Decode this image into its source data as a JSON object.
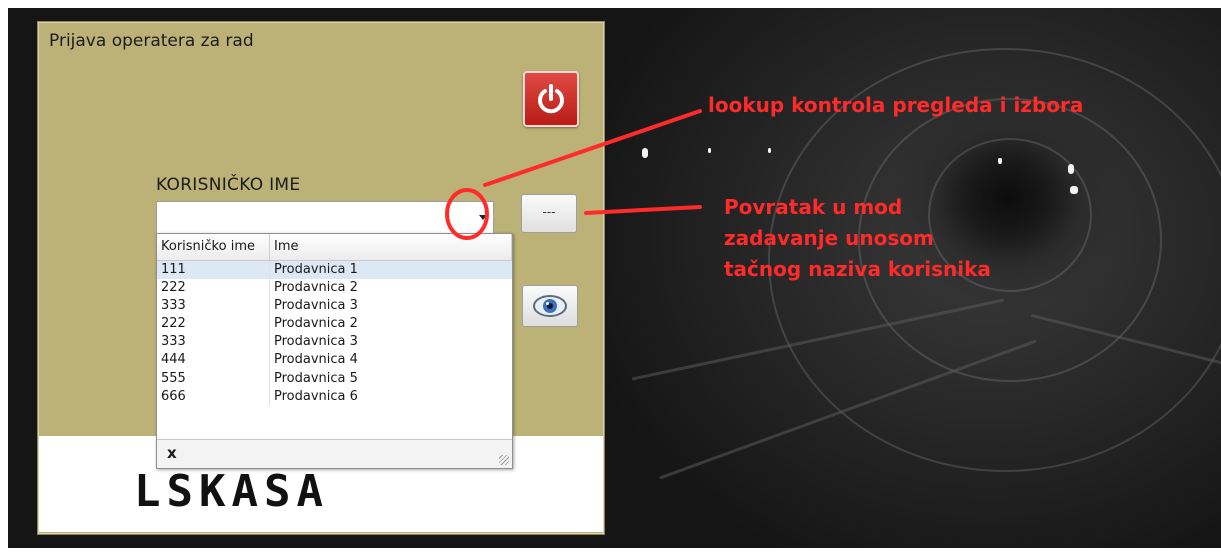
{
  "window": {
    "title": "Prijava operatera za rad"
  },
  "login": {
    "field_label": "KORISNIČKO IME",
    "username_value": "",
    "dots_button_label": "---"
  },
  "lookup": {
    "columns": [
      "Korisničko ime",
      "Ime"
    ],
    "rows": [
      {
        "code": "111",
        "name": "Prodavnica 1"
      },
      {
        "code": "222",
        "name": "Prodavnica 2"
      },
      {
        "code": "333",
        "name": "Prodavnica 3"
      },
      {
        "code": "222",
        "name": "Prodavnica 2"
      },
      {
        "code": "333",
        "name": "Prodavnica 3"
      },
      {
        "code": "444",
        "name": "Prodavnica 4"
      },
      {
        "code": "555",
        "name": "Prodavnica 5"
      },
      {
        "code": "666",
        "name": "Prodavnica 6"
      }
    ],
    "selected_row": 0,
    "close_label": "x"
  },
  "logo": {
    "text": "LSKASA"
  },
  "annotations": {
    "lookup_note": "lookup kontrola pregleda i izbora",
    "return_note_line1": "Povratak u mod",
    "return_note_line2": "zadavanje unosom",
    "return_note_line3": "tačnog naziva korisnika"
  },
  "icons": [
    "power-icon",
    "dropdown-arrow-icon",
    "eye-icon",
    "close-icon",
    "resize-grip-icon"
  ],
  "colors": {
    "window_bg": "#bcb277",
    "annotation": "#ff2a2a",
    "power_button": "#d0302a",
    "selected_row": "#dde8f5"
  }
}
